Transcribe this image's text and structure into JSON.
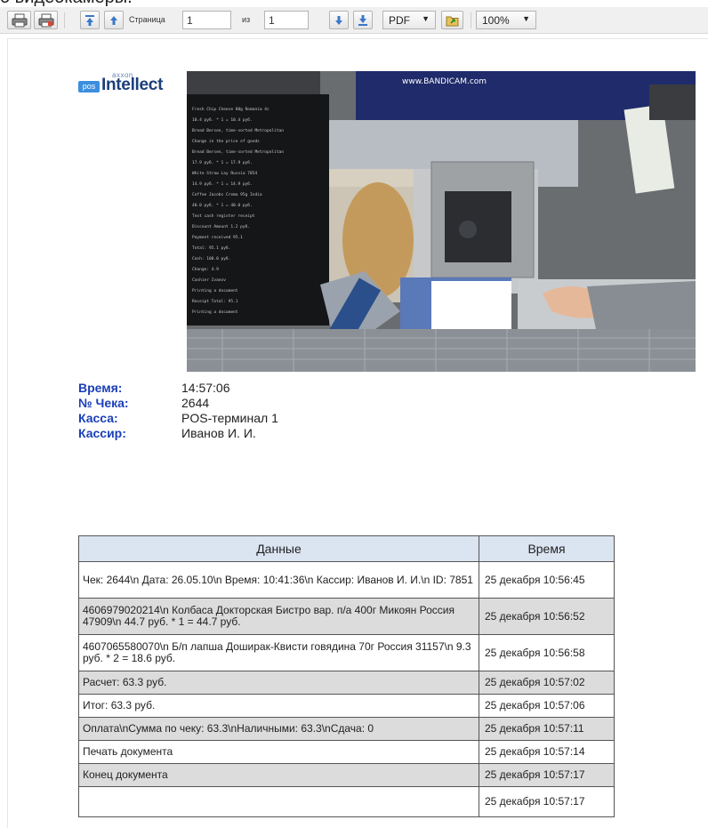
{
  "page": {
    "heading": "о видеокамеры."
  },
  "toolbar": {
    "page_label": "Страница",
    "page_value": "1",
    "of_label": "из",
    "total_pages": "1",
    "format": "PDF",
    "zoom": "100%",
    "icons": [
      "print-icon",
      "print-setup-icon",
      "first-page-icon",
      "previous-page-icon",
      "next-page-icon",
      "last-page-icon",
      "export-icon"
    ]
  },
  "logo": {
    "vendor": "axxon",
    "badge": "pos",
    "product": "Intellect"
  },
  "camera": {
    "watermark": "www.BANDICAM.com"
  },
  "receipt_info": {
    "time_label": "Время:",
    "time_value": "14:57:06",
    "check_label": "№ Чека:",
    "check_value": "2644",
    "register_label": "Касса:",
    "register_value": "POS-терминал 1",
    "cashier_label": "Кассир:",
    "cashier_value": "Иванов И. И."
  },
  "table": {
    "headers": [
      "Данные",
      "Время"
    ],
    "rows": [
      {
        "data": "Чек: 2644\\n Дата: 26.05.10\\n Время: 10:41:36\\n Кассир: Иванов И. И.\\n ID: 7851",
        "time": "25 декабря 10:56:45"
      },
      {
        "data": "4606979020214\\n Колбаса Докторская Бистро вар. п/а 400г Микоян Россия 47909\\n 44.7 руб. * 1 = 44.7 руб.",
        "time": "25 декабря 10:56:52"
      },
      {
        "data": "4607065580070\\n Б/п лапша Доширак-Квисти говядина 70г Россия 31157\\n 9.3 руб. * 2 = 18.6 руб.",
        "time": "25 декабря 10:56:58"
      },
      {
        "data": "Расчет: 63.3 руб.",
        "time": "25 декабря 10:57:02"
      },
      {
        "data": "Итог: 63.3 руб.",
        "time": "25 декабря 10:57:06"
      },
      {
        "data": "Оплата\\nСумма по чеку: 63.3\\nНаличными: 63.3\\nСдача: 0",
        "time": "25 декабря 10:57:11"
      },
      {
        "data": "Печать документа",
        "time": "25 декабря 10:57:14"
      },
      {
        "data": "Конец документа",
        "time": "25 декабря 10:57:17"
      },
      {
        "data": "",
        "time": "25 декабря 10:57:17"
      }
    ]
  }
}
